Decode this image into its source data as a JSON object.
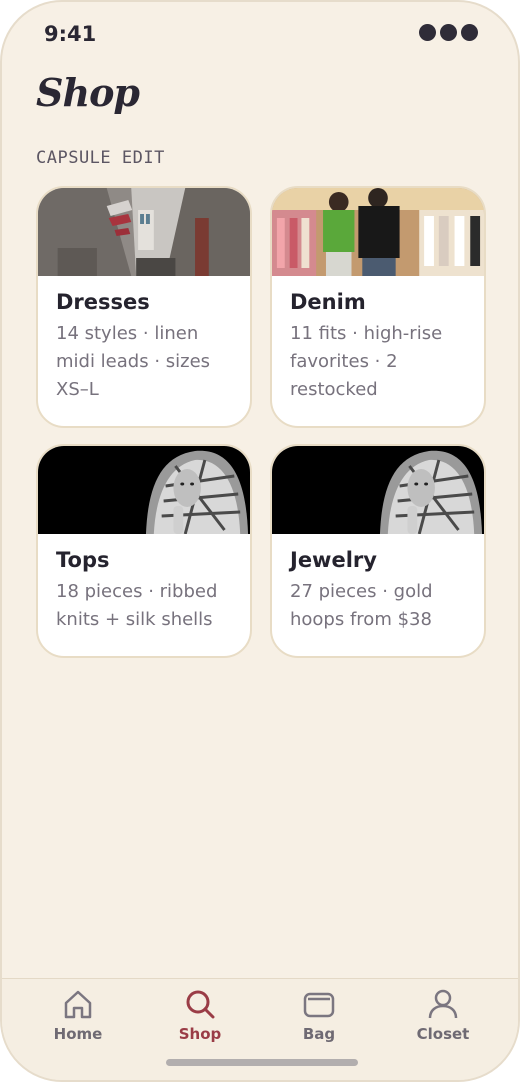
{
  "status": {
    "time": "9:41"
  },
  "page": {
    "title": "Shop",
    "section_label": "CAPSULE EDIT"
  },
  "cards": [
    {
      "title": "Dresses",
      "description": "14 styles · linen midi leads · sizes XS–L",
      "image": "narrow-alley-street-photo"
    },
    {
      "title": "Denim",
      "description": "11 fits · high-rise favorites · 2 restocked",
      "image": "clothing-store-shoppers-photo"
    },
    {
      "title": "Tops",
      "description": "18 pieces · ribbed knits + silk shells",
      "image": "woman-in-patterned-headscarf-photo"
    },
    {
      "title": "Jewelry",
      "description": "27 pieces · gold hoops from $38",
      "image": "woman-in-patterned-headscarf-photo"
    }
  ],
  "tabs": [
    {
      "label": "Home",
      "icon": "home-icon",
      "active": false
    },
    {
      "label": "Shop",
      "icon": "search-icon",
      "active": true
    },
    {
      "label": "Bag",
      "icon": "wallet-icon",
      "active": false
    },
    {
      "label": "Closet",
      "icon": "user-icon",
      "active": false
    }
  ],
  "colors": {
    "background": "#f7f0e5",
    "card": "#ffffff",
    "card_border": "#e8dcc5",
    "accent": "#9a3c46",
    "text_primary": "#25232e",
    "text_secondary": "#77727d"
  }
}
